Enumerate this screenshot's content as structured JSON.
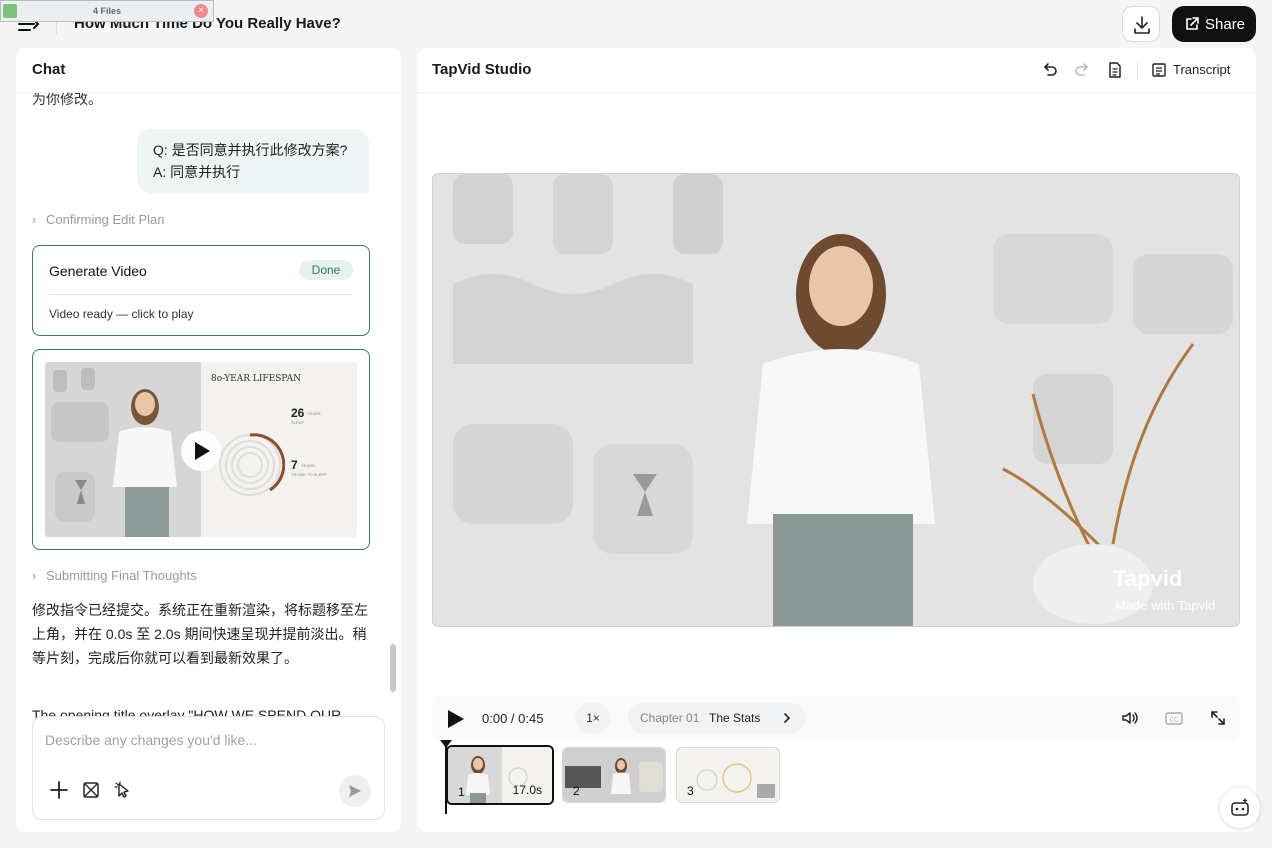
{
  "header": {
    "title": "How Much Time Do You Really Have?",
    "files_chip": "4 Files",
    "share_label": "Share"
  },
  "chat": {
    "header": "Chat",
    "top_text": "为你修改。",
    "user_q": "Q: 是否同意并执行此修改方案?",
    "user_a": "A: 同意并执行",
    "step1": "Confirming Edit Plan",
    "gen_title": "Generate Video",
    "gen_status": "Done",
    "gen_sub": "Video ready — click to play",
    "thumb": {
      "title": "8o-YEAR LIFESPAN",
      "stat1_num": "26",
      "stat1_unit": "YEARS",
      "stat1_desc": "SLEEP",
      "stat2_num": "7",
      "stat2_unit": "YEARS",
      "stat2_desc": "TRYING TO SLEEP"
    },
    "step2": "Submitting Final Thoughts",
    "reply_text": "修改指令已经提交。系统正在重新渲染，将标题移至左上角，并在 0.0s 至 2.0s 期间快速呈现并提前淡出。稍等片刻，完成后你就可以看到最新效果了。",
    "reply_cut": "The opening title overlay \"HOW WE SPEND OUR",
    "composer_placeholder": "Describe any changes you'd like..."
  },
  "studio": {
    "title": "TapVid Studio",
    "transcript_label": "Transcript",
    "watermark_logo": "Tapvid",
    "watermark_sub": "Made with Tapvid",
    "player": {
      "time": "0:00 / 0:45",
      "speed": "1×",
      "chapter_label": "Chapter 01",
      "chapter_name": "The Stats"
    },
    "clips": [
      {
        "num": "1",
        "duration": "17.0s"
      },
      {
        "num": "2"
      },
      {
        "num": "3"
      }
    ]
  },
  "colors": {
    "accent_green": "#3d7a63",
    "done_badge_bg": "#e6f3ec",
    "share_bg": "#111111"
  }
}
